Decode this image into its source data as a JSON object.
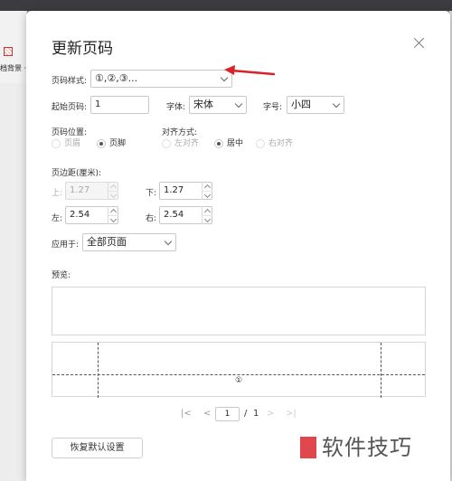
{
  "background": {
    "ribbon_label": "档背景 ·"
  },
  "dialog": {
    "title": "更新页码",
    "style_label": "页码样式:",
    "style_value": "①,②,③...",
    "start_label": "起始页码:",
    "start_value": "1",
    "font_label": "字体:",
    "font_value": "宋体",
    "size_label": "字号:",
    "size_value": "小四",
    "position_label": "页码位置:",
    "position_options": [
      "页眉",
      "页脚"
    ],
    "position_selected": "页脚",
    "align_label": "对齐方式:",
    "align_options": [
      "左对齐",
      "居中",
      "右对齐"
    ],
    "align_selected": "居中",
    "margin_label": "页边距(厘米):",
    "margin_top_label": "上:",
    "margin_top_value": "1.27",
    "margin_bottom_label": "下:",
    "margin_bottom_value": "1.27",
    "margin_left_label": "左:",
    "margin_left_value": "2.54",
    "margin_right_label": "右:",
    "margin_right_value": "2.54",
    "apply_label": "应用于:",
    "apply_value": "全部页面",
    "preview_label": "预览:",
    "preview_page_mark": "①",
    "pager": {
      "first": "|<",
      "prev": "<",
      "current": "1",
      "separator": "/",
      "total": "1",
      "next": ">",
      "last": ">|"
    },
    "reset_label": "恢复默认设置"
  },
  "watermark": {
    "text": "软件技巧"
  },
  "colors": {
    "arrow": "#d9232b",
    "watermark_square": "#e0474c"
  }
}
